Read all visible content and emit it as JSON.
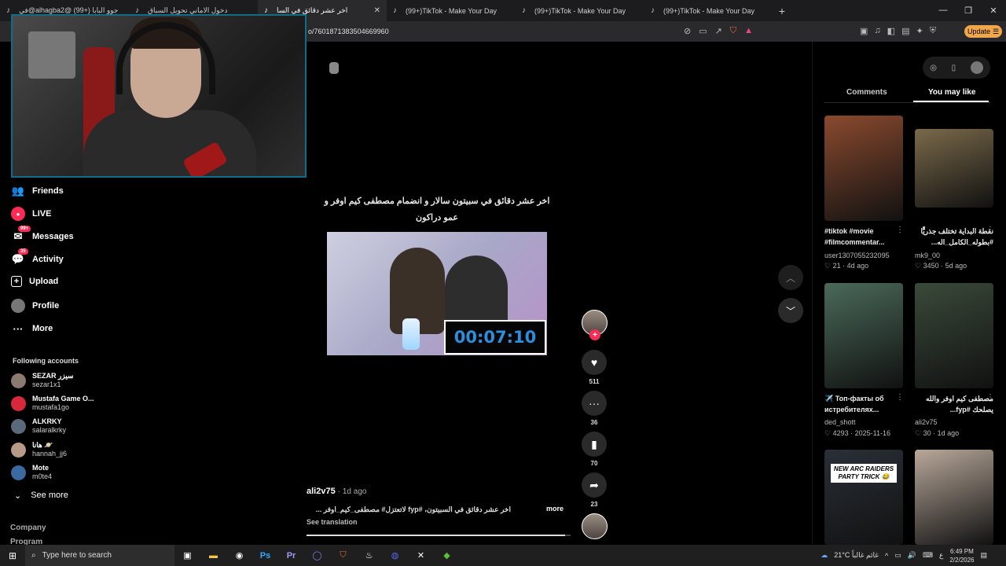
{
  "browser": {
    "tabs": [
      {
        "title": "في@alhagba2@ (99+) جوو البابا",
        "active": false
      },
      {
        "title": "دخول الاماني تحويل السباق",
        "active": false
      },
      {
        "title": "اخر عشر دقائق في السا",
        "active": true
      },
      {
        "title": "(99+)TikTok - Make Your Day",
        "active": false
      },
      {
        "title": "(99+)TikTok - Make Your Day",
        "active": false
      },
      {
        "title": "(99+)TikTok - Make Your Day",
        "active": false
      }
    ],
    "url": "o/7601871383504669960",
    "update_label": "Update"
  },
  "sidebar": {
    "nav": [
      {
        "label": "Friends",
        "icon": "friends-icon"
      },
      {
        "label": "LIVE",
        "icon": "live-icon"
      },
      {
        "label": "Messages",
        "icon": "messages-icon",
        "badge": "99+"
      },
      {
        "label": "Activity",
        "icon": "activity-icon",
        "badge": "35"
      },
      {
        "label": "Upload",
        "icon": "upload-icon"
      },
      {
        "label": "Profile",
        "icon": "profile-icon"
      },
      {
        "label": "More",
        "icon": "more-icon"
      }
    ],
    "following_title": "Following accounts",
    "accounts": [
      {
        "name": "SEZAR سيزر",
        "handle": "sezar1x1"
      },
      {
        "name": "Mustafa Game O...",
        "handle": "mustafa1go"
      },
      {
        "name": "ALKRKY",
        "handle": "salaralkrky"
      },
      {
        "name": "هانا 🪐",
        "handle": "hannah_jj6"
      },
      {
        "name": "Mote",
        "handle": "m0te4"
      }
    ],
    "see_more": "See more",
    "footer": [
      "Company",
      "Program"
    ]
  },
  "video": {
    "title": "اخر عشر دقائق في سبيتون سالار و انضمام مصطفى كيم اوفر و عمو دراكون",
    "timer": "00:07:10",
    "author": "ali2v75",
    "posted": "· 1d ago",
    "caption": "اخر عشر دقائق في السبيتون، #fyp لاتعتزل# مصطفى_كيم_اوفر ...",
    "more_label": "more",
    "translate_label": "See translation",
    "progress": 0.98,
    "actions": [
      {
        "name": "like",
        "icon": "heart-icon",
        "count": "511"
      },
      {
        "name": "comment",
        "icon": "comment-icon",
        "count": "36"
      },
      {
        "name": "save",
        "icon": "bookmark-icon",
        "count": "70"
      },
      {
        "name": "share",
        "icon": "share-icon",
        "count": "23"
      }
    ]
  },
  "right_panel": {
    "tabs": [
      "Comments",
      "You may like"
    ],
    "active_tab": "You may like",
    "cards": [
      {
        "title": "#tiktok #movie #filmcommentar...",
        "user": "user1307055232095",
        "likes": "21",
        "date": "4d ago",
        "color": "#8a4a2e"
      },
      {
        "title": "نقطة البداية تختلف جذريًّا #بطوله_الكامل_اله...",
        "user": "mk9_00",
        "likes": "3450",
        "date": "5d ago",
        "color": "#7a6a4a"
      },
      {
        "title": "✈️ Топ-факты об истребителях...",
        "user": "ded_shott",
        "likes": "4293",
        "date": "2025-11-16",
        "color": "#4a6a5a"
      },
      {
        "title": "مصطفى كيم اوفر والله يصلحك #fyp...",
        "user": "ali2v75",
        "likes": "30",
        "date": "1d ago",
        "color": "#3a4a3a"
      },
      {
        "title": "NEW ARC RAIDERS PARTY TRICK 😂",
        "user": "",
        "likes": "",
        "date": "",
        "color": "#2a3038"
      },
      {
        "title": "",
        "user": "",
        "likes": "",
        "date": "",
        "color": "#b8a89a"
      }
    ]
  },
  "taskbar": {
    "search_placeholder": "Type here to search",
    "weather": "21°C غائم غالباً",
    "time": "6:49 PM",
    "date": "2/2/2026",
    "lang": "ع"
  }
}
